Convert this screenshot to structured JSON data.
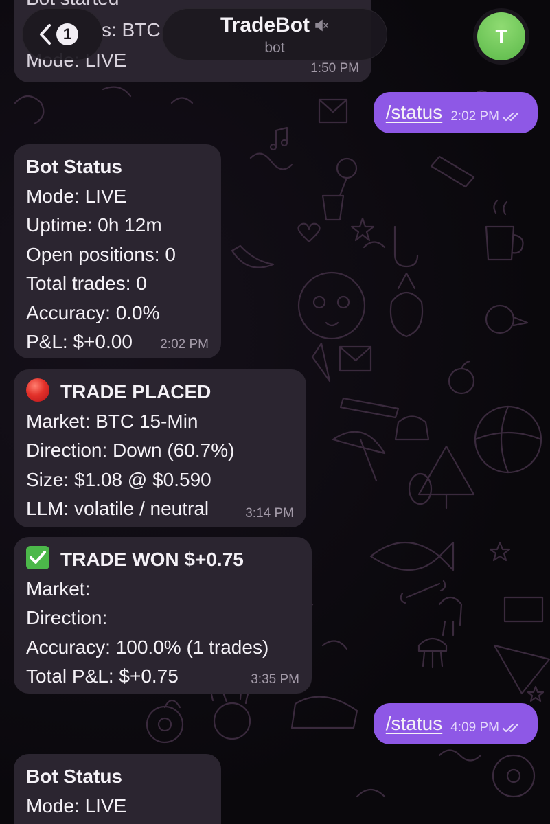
{
  "header": {
    "back_count": "1",
    "title": "TradeBot",
    "subtitle": "bot",
    "avatar_letter": "T",
    "avatar_color": "#5cb94a"
  },
  "colors": {
    "incoming_bubble": "#2b2530",
    "outgoing_bubble": "#8e58e6",
    "background": "#0c0a0f"
  },
  "top_message": {
    "lines": [
      "Bot started",
      "s: BTC",
      "Mode: LIVE"
    ],
    "time": "1:50 PM"
  },
  "messages": [
    {
      "kind": "outgoing",
      "text": "/status",
      "time": "2:02 PM"
    },
    {
      "kind": "incoming",
      "title": "Bot Status",
      "lines": [
        "Mode: LIVE",
        "Uptime: 0h 12m",
        "Open positions: 0",
        "Total trades: 0",
        "Accuracy: 0.0%",
        "P&L: $+0.00"
      ],
      "time": "2:02 PM"
    },
    {
      "kind": "incoming",
      "icon": "red-circle-icon",
      "title": "TRADE PLACED",
      "lines": [
        "Market: BTC 15-Min",
        "Direction: Down (60.7%)",
        "Size: $1.08 @ $0.590",
        "LLM: volatile / neutral"
      ],
      "time": "3:14 PM"
    },
    {
      "kind": "incoming",
      "icon": "check-mark-icon",
      "title": "TRADE WON $+0.75",
      "lines": [
        "Market:",
        "Direction:",
        "Accuracy: 100.0% (1 trades)",
        "Total P&L: $+0.75"
      ],
      "time": "3:35 PM"
    },
    {
      "kind": "outgoing",
      "text": "/status",
      "time": "4:09 PM"
    },
    {
      "kind": "incoming",
      "title": "Bot Status",
      "lines": [
        "Mode: LIVE"
      ],
      "time": ""
    }
  ]
}
